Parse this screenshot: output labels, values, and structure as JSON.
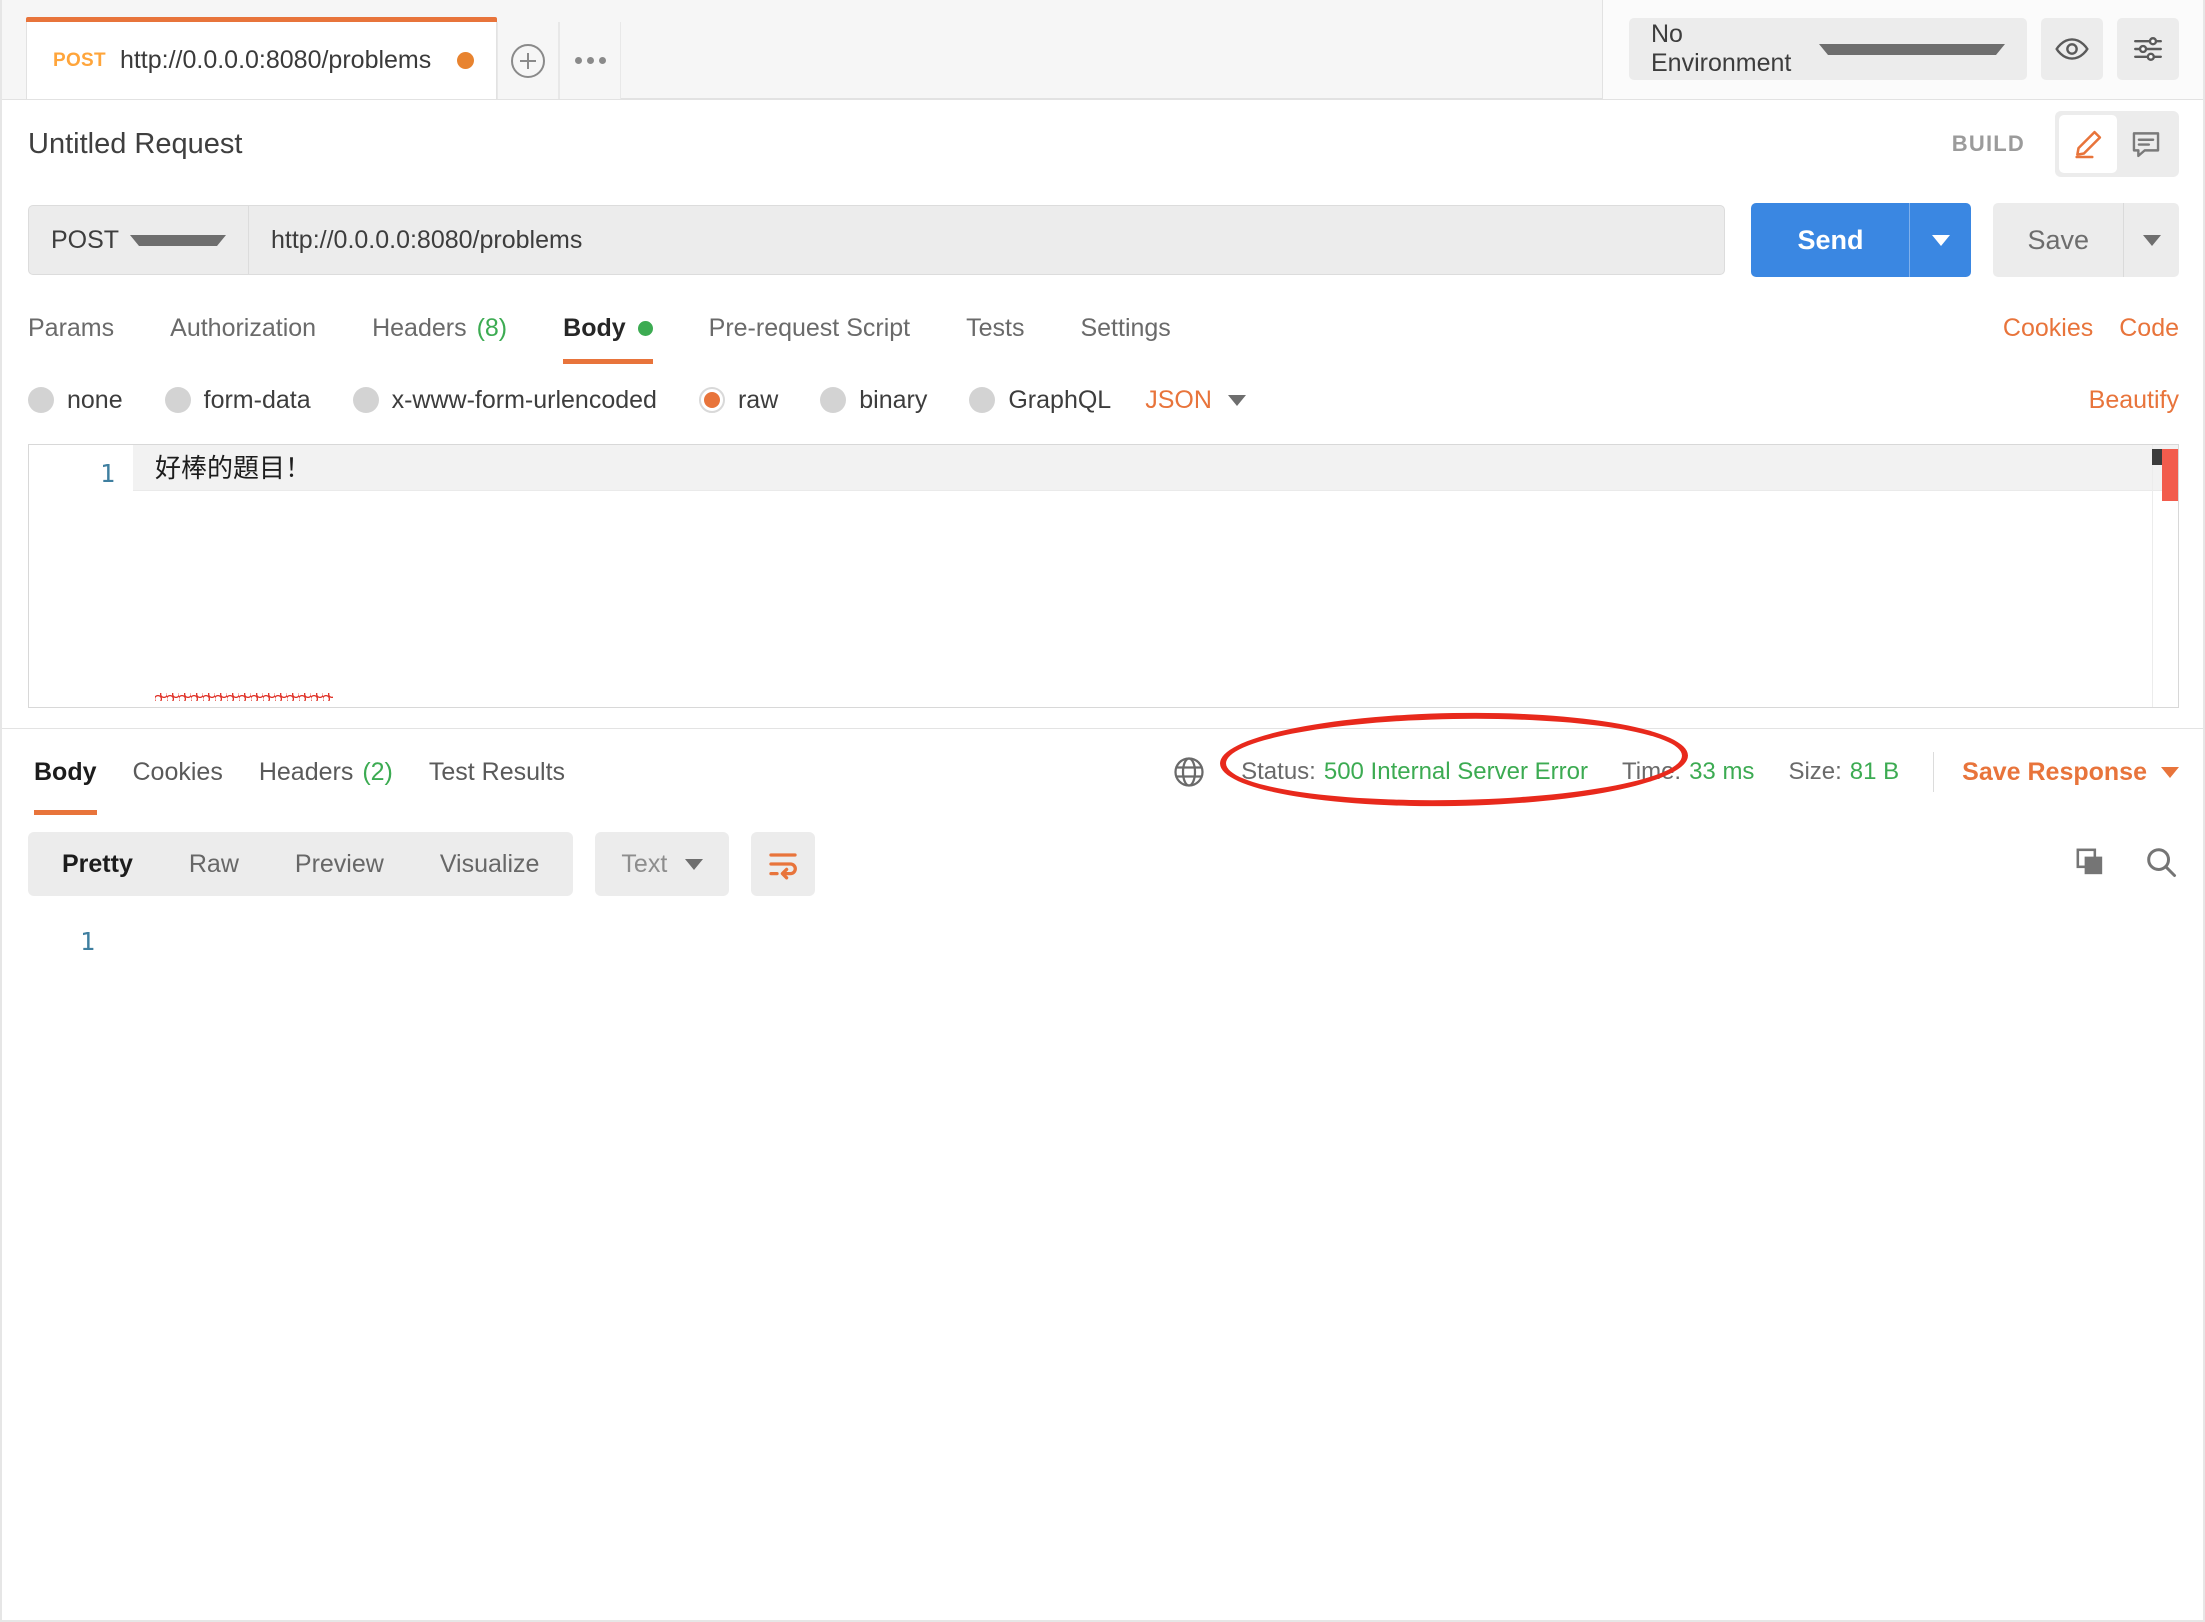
{
  "tabbar": {
    "request_tab": {
      "method": "POST",
      "url": "http://0.0.0.0:8080/problems",
      "unsaved_indicator": "unsaved-dot"
    },
    "new_tab_icon": "plus-circle-icon",
    "tab_options_icon": "ellipsis-icon",
    "environment": {
      "selected": "No Environment",
      "eye_icon": "eye-icon",
      "settings_icon": "sliders-icon"
    }
  },
  "header": {
    "title": "Untitled Request",
    "build_label": "BUILD",
    "edit_icon": "pencil-icon",
    "comment_icon": "comment-icon"
  },
  "request": {
    "method": "POST",
    "url": "http://0.0.0.0:8080/problems",
    "send_label": "Send",
    "save_label": "Save",
    "tabs": [
      {
        "label": "Params",
        "count": "",
        "active": false
      },
      {
        "label": "Authorization",
        "count": "",
        "active": false
      },
      {
        "label": "Headers",
        "count": "(8)",
        "active": false
      },
      {
        "label": "Body",
        "count": "",
        "active": true
      },
      {
        "label": "Pre-request Script",
        "count": "",
        "active": false
      },
      {
        "label": "Tests",
        "count": "",
        "active": false
      },
      {
        "label": "Settings",
        "count": "",
        "active": false
      }
    ],
    "links": {
      "cookies": "Cookies",
      "code": "Code"
    },
    "body_types": [
      {
        "label": "none",
        "selected": false
      },
      {
        "label": "form-data",
        "selected": false
      },
      {
        "label": "x-www-form-urlencoded",
        "selected": false
      },
      {
        "label": "raw",
        "selected": true
      },
      {
        "label": "binary",
        "selected": false
      },
      {
        "label": "GraphQL",
        "selected": false
      }
    ],
    "body_format": "JSON",
    "beautify_label": "Beautify",
    "editor": {
      "line_number": "1",
      "content": "好棒的題目！"
    }
  },
  "response": {
    "tabs": [
      {
        "label": "Body",
        "count": "",
        "active": true
      },
      {
        "label": "Cookies",
        "count": "",
        "active": false
      },
      {
        "label": "Headers",
        "count": "(2)",
        "active": false
      },
      {
        "label": "Test Results",
        "count": "",
        "active": false
      }
    ],
    "globe_icon": "globe-icon",
    "status_label": "Status:",
    "status_value": "500 Internal Server Error",
    "time_label": "Time:",
    "time_value": "33 ms",
    "size_label": "Size:",
    "size_value": "81 B",
    "save_response_label": "Save Response",
    "toolbar": {
      "views": [
        {
          "label": "Pretty",
          "active": true
        },
        {
          "label": "Raw",
          "active": false
        },
        {
          "label": "Preview",
          "active": false
        },
        {
          "label": "Visualize",
          "active": false
        }
      ],
      "format": "Text",
      "wrap_icon": "word-wrap-icon",
      "copy_icon": "copy-icon",
      "search_icon": "search-icon"
    },
    "body": {
      "line_number": "1",
      "content": ""
    }
  },
  "colors": {
    "accent_orange": "#e8743b",
    "send_blue": "#3a87e2",
    "status_green": "#3cab52",
    "annotation_red": "#e8291c"
  }
}
